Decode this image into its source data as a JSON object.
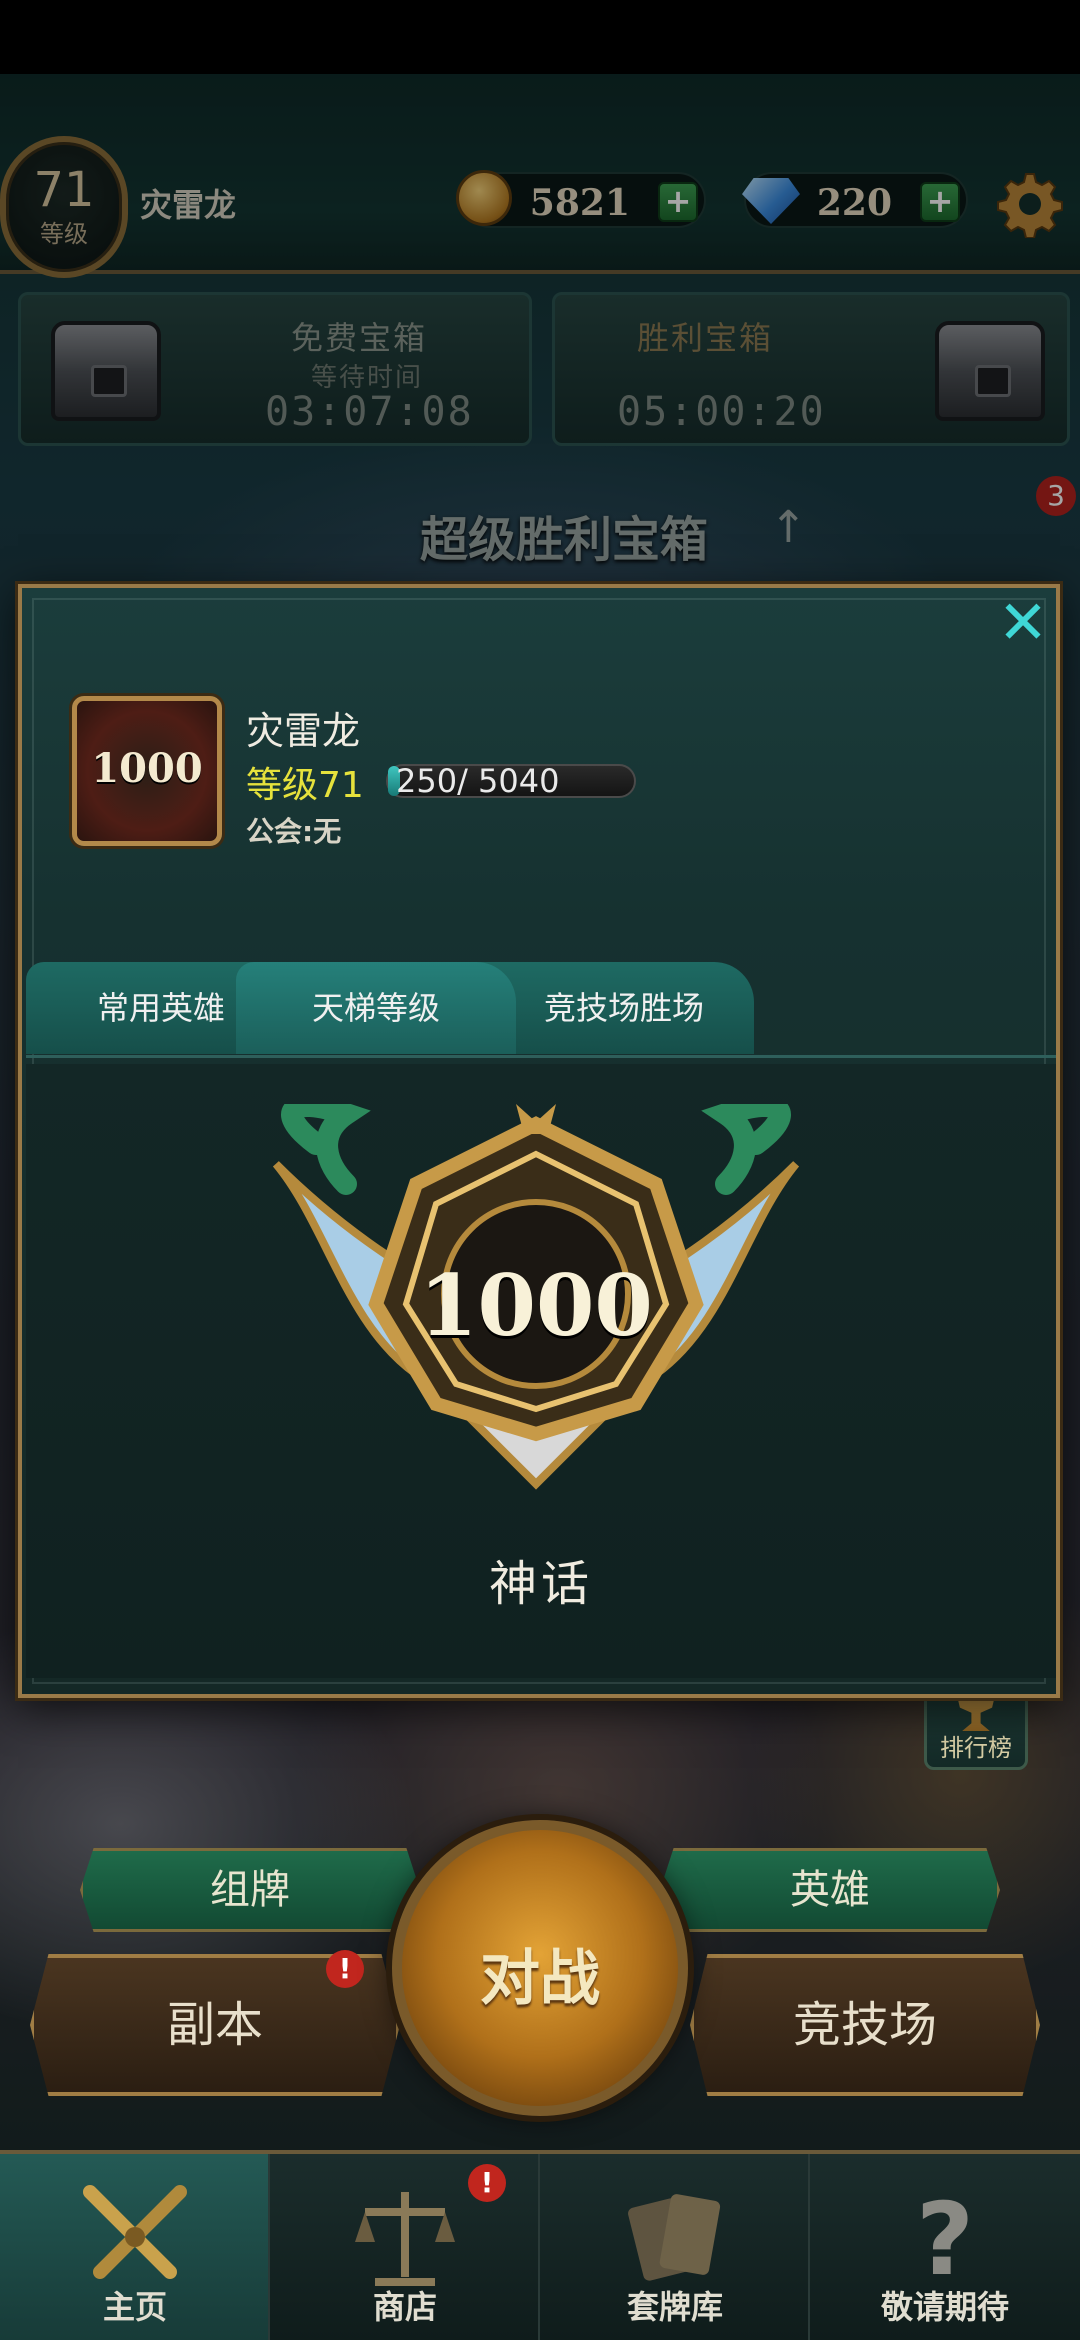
{
  "header": {
    "level": "71",
    "level_label": "等级",
    "player_name": "灾雷龙",
    "gold": "5821",
    "gems": "220",
    "plus": "+"
  },
  "chests": {
    "free": {
      "title": "免费宝箱",
      "subtitle": "等待时间",
      "time": "03:07:08"
    },
    "victory": {
      "title": "胜利宝箱",
      "time": "05:00:20"
    },
    "super_label": "超级胜利宝箱",
    "super_arrow": "↑",
    "super_badge": "3"
  },
  "profile_modal": {
    "close": "✕",
    "avatar_rank": "1000",
    "name": "灾雷龙",
    "level": "等级71",
    "xp_text": "250/ 5040",
    "xp_current": 250,
    "xp_max": 5040,
    "guild": "公会:无",
    "tabs": [
      {
        "label": "常用英雄"
      },
      {
        "label": "天梯等级"
      },
      {
        "label": "竞技场胜场"
      }
    ],
    "active_tab": 1,
    "rank_points": "1000",
    "rank_title": "神话"
  },
  "side": {
    "ranking_label": "排行榜"
  },
  "actions": {
    "deck": "组牌",
    "hero": "英雄",
    "dungeon": "副本",
    "battle": "对战",
    "arena": "竞技场",
    "alert": "!"
  },
  "nav": {
    "items": [
      {
        "label": "主页"
      },
      {
        "label": "商店"
      },
      {
        "label": "套牌库"
      },
      {
        "label": "敬请期待"
      }
    ],
    "shop_alert": "!"
  },
  "colors": {
    "accent_teal": "#3fd7d6",
    "level_yellow": "#e6e23c",
    "gold_border": "#9a7a48",
    "alert_red": "#c1261e"
  }
}
